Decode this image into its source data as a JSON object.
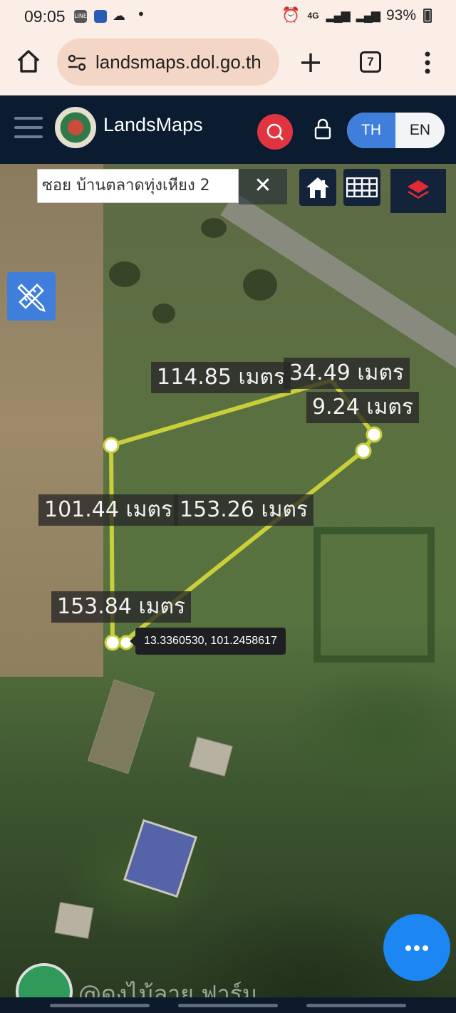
{
  "status_bar": {
    "time": "09:05",
    "network": "4G",
    "battery": "93%"
  },
  "browser": {
    "url": "landsmaps.dol.go.th",
    "tab_count": "7"
  },
  "app": {
    "title": "LandsMaps",
    "lang_th": "TH",
    "lang_en": "EN"
  },
  "map": {
    "search_value": "ซอย บ้านตลาดทุ่งเหียง 2",
    "clear_symbol": "✕",
    "coordinate_tooltip": "13.3360530, 101.2458617",
    "watermark": "@ดงไม้ลาย ฟาร์ม"
  },
  "measurements": {
    "m1": "114.85 เมตร",
    "m2": "34.49 เมตร",
    "m3": "9.24 เมตร",
    "m4": "101.44 เมตร",
    "m5": "153.26 เมตร",
    "m6": "153.84 เมตร"
  },
  "colors": {
    "header_bg": "#0b1c30",
    "accent_blue": "#3f7fdb",
    "search_red": "#e03540",
    "measure_line": "#c8cf3a",
    "fab_blue": "#1c86f2"
  }
}
